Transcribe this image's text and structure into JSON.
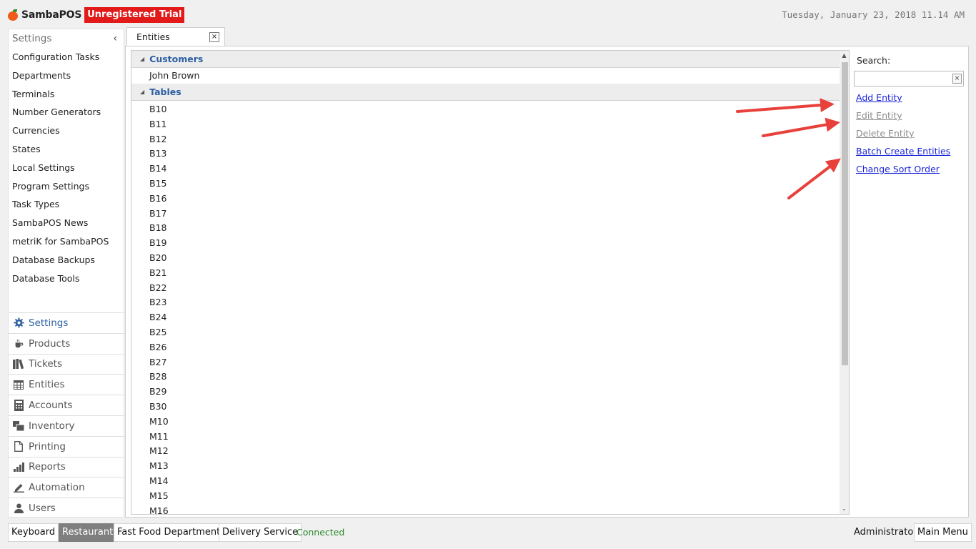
{
  "header": {
    "logo_text": "SambaPOS",
    "trial_badge": "Unregistered Trial",
    "datetime": "Tuesday, January 23, 2018 11.14 AM"
  },
  "left_panel": {
    "title": "Settings",
    "collapse_glyph": "‹",
    "items": [
      "Configuration Tasks",
      "Departments",
      "Terminals",
      "Number Generators",
      "Currencies",
      "States",
      "Local Settings",
      "Program Settings",
      "Task Types",
      "SambaPOS News",
      "metriK for SambaPOS",
      "Database Backups",
      "Database Tools"
    ],
    "nav": [
      {
        "label": "Settings",
        "icon": "gear-icon"
      },
      {
        "label": "Products",
        "icon": "coffee-icon"
      },
      {
        "label": "Tickets",
        "icon": "books-icon"
      },
      {
        "label": "Entities",
        "icon": "table-icon"
      },
      {
        "label": "Accounts",
        "icon": "calculator-icon"
      },
      {
        "label": "Inventory",
        "icon": "inventory-icon"
      },
      {
        "label": "Printing",
        "icon": "document-icon"
      },
      {
        "label": "Reports",
        "icon": "bar-chart-icon"
      },
      {
        "label": "Automation",
        "icon": "pencil-icon"
      },
      {
        "label": "Users",
        "icon": "user-icon"
      }
    ],
    "active_nav": "Settings"
  },
  "tab": {
    "label": "Entities",
    "close_glyph": "×"
  },
  "entity_list": {
    "groups": [
      {
        "name": "Customers",
        "items": [
          "John Brown"
        ]
      },
      {
        "name": "Tables",
        "items": [
          "B10",
          "B11",
          "B12",
          "B13",
          "B14",
          "B15",
          "B16",
          "B17",
          "B18",
          "B19",
          "B20",
          "B21",
          "B22",
          "B23",
          "B24",
          "B25",
          "B26",
          "B27",
          "B28",
          "B29",
          "B30",
          "M10",
          "M11",
          "M12",
          "M13",
          "M14",
          "M15",
          "M16"
        ]
      }
    ]
  },
  "sidebar": {
    "search_label": "Search:",
    "search_value": "",
    "clear_glyph": "×",
    "actions": [
      {
        "label": "Add Entity",
        "enabled": true
      },
      {
        "label": "Edit Entity",
        "enabled": false
      },
      {
        "label": "Delete Entity",
        "enabled": false
      },
      {
        "label": "Batch Create Entities",
        "enabled": true
      },
      {
        "label": "Change Sort Order",
        "enabled": true
      }
    ]
  },
  "bottom_bar": {
    "buttons": [
      {
        "label": "Keyboard",
        "selected": false
      },
      {
        "label": "Restaurant",
        "selected": true
      },
      {
        "label": "Fast Food Department",
        "selected": false
      },
      {
        "label": "Delivery Service",
        "selected": false
      }
    ],
    "status": "Connected",
    "user": "Administrator",
    "main_menu": "Main Menu"
  },
  "colors": {
    "accent_blue": "#2d5fa3",
    "link_blue": "#1a23d8",
    "trial_red": "#e21a1a",
    "status_green": "#2a8a2a",
    "annotation_arrow": "#e8403a"
  }
}
